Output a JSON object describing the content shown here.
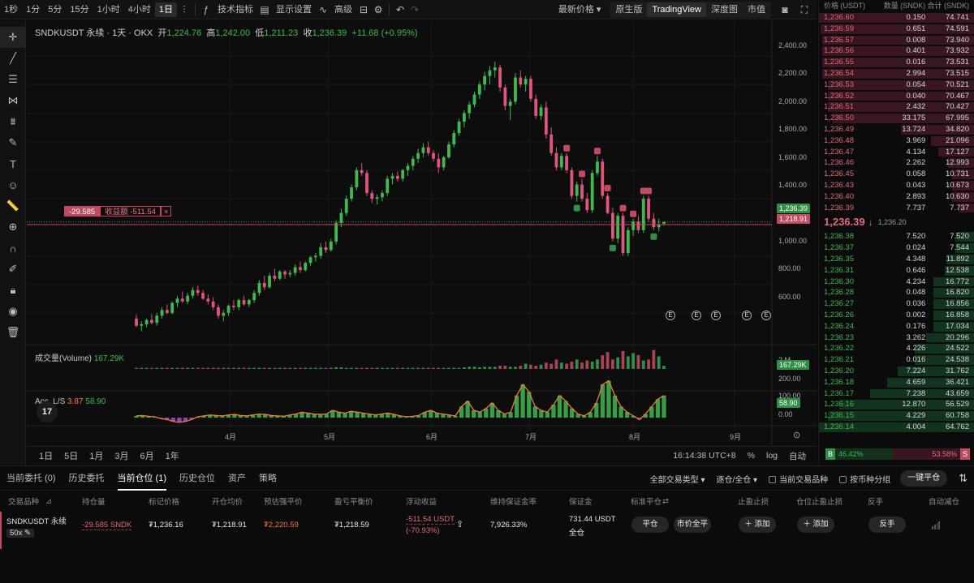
{
  "toolbar": {
    "intervals": [
      "1秒",
      "1分",
      "5分",
      "15分",
      "1小时",
      "4小时",
      "1日"
    ],
    "active_interval": "1日",
    "indicators": "技术指标",
    "display": "显示设置",
    "advanced": "高级",
    "price_type": "最新价格",
    "views": [
      "原生版",
      "TradingView",
      "深度图",
      "市值"
    ],
    "active_view": "TradingView"
  },
  "chart": {
    "legend": {
      "symbol": "SNDKUSDT 永续 · 1天 · OKX",
      "open_label": "开",
      "open": "1,224.76",
      "high_label": "高",
      "high": "1,242.00",
      "low_label": "低",
      "low": "1,211.23",
      "close_label": "收",
      "close": "1,236.39",
      "change": "+11.68 (+0.95%)"
    },
    "price_axis": [
      "2,400.00",
      "2,200.00",
      "2,000.00",
      "1,800.00",
      "1,600.00",
      "1,400.00",
      "1,000.00",
      "800.00",
      "600.00"
    ],
    "last_price_tag": "1,236.39",
    "entry_price_tag": "1,218.91",
    "position_tag": {
      "qty": "-29.585",
      "pnl": "收益额 -511.54",
      "close": "×"
    },
    "volume_legend": {
      "label": "成交量(Volume)",
      "value": "167.29K"
    },
    "volume_axis": "2 M",
    "volume_tag": "167.29K",
    "accls_legend": {
      "label": "Acc. L/S",
      "v1": "3.87",
      "v2": "58.90"
    },
    "accls_axis": [
      "200.00",
      "100.00",
      "0.00"
    ],
    "accls_tag": "58.90",
    "time_axis": [
      "4月",
      "5月",
      "6月",
      "7月",
      "8月",
      "9月"
    ],
    "ranges": [
      "1日",
      "5日",
      "1月",
      "3月",
      "6月",
      "1年"
    ],
    "clock": "16:14:38 UTC+8",
    "percent": "%",
    "log": "log",
    "auto": "自动",
    "badges": {
      "earnings": "E",
      "sell": "S",
      "buy": "B"
    }
  },
  "chart_data": {
    "type": "candlestick",
    "y_range": [
      480,
      2480
    ],
    "candles": [
      [
        560,
        590,
        500,
        510
      ],
      [
        510,
        540,
        470,
        520
      ],
      [
        520,
        560,
        500,
        550
      ],
      [
        550,
        590,
        520,
        530
      ],
      [
        530,
        600,
        510,
        580
      ],
      [
        580,
        640,
        560,
        620
      ],
      [
        620,
        660,
        590,
        600
      ],
      [
        600,
        680,
        590,
        670
      ],
      [
        670,
        720,
        640,
        700
      ],
      [
        700,
        750,
        670,
        680
      ],
      [
        680,
        740,
        660,
        720
      ],
      [
        720,
        780,
        700,
        760
      ],
      [
        760,
        790,
        720,
        740
      ],
      [
        740,
        760,
        690,
        700
      ],
      [
        700,
        730,
        660,
        680
      ],
      [
        680,
        710,
        620,
        640
      ],
      [
        640,
        660,
        560,
        580
      ],
      [
        580,
        620,
        540,
        600
      ],
      [
        600,
        660,
        580,
        650
      ],
      [
        650,
        690,
        620,
        640
      ],
      [
        640,
        700,
        620,
        690
      ],
      [
        690,
        720,
        650,
        660
      ],
      [
        660,
        700,
        640,
        690
      ],
      [
        690,
        760,
        670,
        740
      ],
      [
        740,
        830,
        720,
        810
      ],
      [
        810,
        860,
        760,
        780
      ],
      [
        780,
        880,
        770,
        860
      ],
      [
        860,
        910,
        820,
        840
      ],
      [
        840,
        900,
        830,
        890
      ],
      [
        890,
        900,
        840,
        870
      ],
      [
        870,
        900,
        850,
        880
      ],
      [
        880,
        940,
        860,
        920
      ],
      [
        920,
        960,
        880,
        900
      ],
      [
        900,
        960,
        890,
        950
      ],
      [
        950,
        1000,
        930,
        990
      ],
      [
        990,
        1020,
        960,
        1000
      ],
      [
        1000,
        1090,
        980,
        1060
      ],
      [
        1060,
        1100,
        1020,
        1040
      ],
      [
        1040,
        1120,
        1030,
        1100
      ],
      [
        1100,
        1250,
        1080,
        1230
      ],
      [
        1230,
        1330,
        1200,
        1300
      ],
      [
        1300,
        1420,
        1280,
        1400
      ],
      [
        1400,
        1500,
        1380,
        1480
      ],
      [
        1480,
        1620,
        1460,
        1600
      ],
      [
        1600,
        1650,
        1560,
        1580
      ],
      [
        1580,
        1600,
        1420,
        1440
      ],
      [
        1440,
        1460,
        1370,
        1400
      ],
      [
        1400,
        1430,
        1360,
        1410
      ],
      [
        1410,
        1460,
        1380,
        1440
      ],
      [
        1440,
        1560,
        1420,
        1540
      ],
      [
        1540,
        1580,
        1500,
        1560
      ],
      [
        1560,
        1590,
        1520,
        1540
      ],
      [
        1540,
        1610,
        1520,
        1600
      ],
      [
        1600,
        1650,
        1560,
        1630
      ],
      [
        1630,
        1700,
        1600,
        1680
      ],
      [
        1680,
        1750,
        1650,
        1720
      ],
      [
        1720,
        1790,
        1690,
        1760
      ],
      [
        1760,
        1800,
        1700,
        1720
      ],
      [
        1720,
        1740,
        1660,
        1680
      ],
      [
        1680,
        1720,
        1580,
        1620
      ],
      [
        1620,
        1700,
        1600,
        1690
      ],
      [
        1690,
        1800,
        1680,
        1780
      ],
      [
        1780,
        1880,
        1760,
        1860
      ],
      [
        1860,
        1960,
        1840,
        1940
      ],
      [
        1940,
        2020,
        1900,
        2000
      ],
      [
        2000,
        2080,
        1960,
        2060
      ],
      [
        2060,
        2150,
        2040,
        2130
      ],
      [
        2130,
        2220,
        2100,
        2200
      ],
      [
        2200,
        2290,
        2160,
        2260
      ],
      [
        2260,
        2330,
        2200,
        2300
      ],
      [
        2300,
        2360,
        2250,
        2320
      ],
      [
        2320,
        2340,
        2150,
        2180
      ],
      [
        2180,
        2200,
        2020,
        2050
      ],
      [
        2050,
        2100,
        1950,
        2080
      ],
      [
        2080,
        2280,
        2060,
        2250
      ],
      [
        2250,
        2300,
        2180,
        2200
      ],
      [
        2200,
        2260,
        2150,
        2240
      ],
      [
        2240,
        2260,
        2080,
        2100
      ],
      [
        2100,
        2130,
        1960,
        1980
      ],
      [
        1980,
        2060,
        1950,
        2040
      ],
      [
        2040,
        2080,
        1820,
        1850
      ],
      [
        1850,
        1900,
        1700,
        1720
      ],
      [
        1720,
        1760,
        1600,
        1620
      ],
      [
        1620,
        1720,
        1600,
        1700
      ],
      [
        1700,
        1720,
        1580,
        1600
      ],
      [
        1600,
        1620,
        1400,
        1420
      ],
      [
        1420,
        1520,
        1380,
        1500
      ],
      [
        1500,
        1540,
        1380,
        1400
      ],
      [
        1400,
        1440,
        1300,
        1320
      ],
      [
        1320,
        1600,
        1300,
        1580
      ],
      [
        1580,
        1700,
        1560,
        1660
      ],
      [
        1660,
        1680,
        1400,
        1420
      ],
      [
        1420,
        1440,
        1290,
        1300
      ],
      [
        1300,
        1340,
        1100,
        1120
      ],
      [
        1120,
        1300,
        1090,
        1280
      ],
      [
        1280,
        1300,
        1000,
        1020
      ],
      [
        1020,
        1200,
        1000,
        1180
      ],
      [
        1180,
        1260,
        1140,
        1240
      ],
      [
        1240,
        1280,
        1160,
        1180
      ],
      [
        1180,
        1420,
        1160,
        1400
      ],
      [
        1400,
        1420,
        1240,
        1260
      ],
      [
        1260,
        1300,
        1180,
        1200
      ],
      [
        1200,
        1260,
        1170,
        1220
      ],
      [
        1224.76,
        1242,
        1211.23,
        1236.39
      ]
    ],
    "volume": [
      0.1,
      0.1,
      0.1,
      0.1,
      0.1,
      0.1,
      0.1,
      0.1,
      0.1,
      0.1,
      0.1,
      0.1,
      0.1,
      0.1,
      0.1,
      0.1,
      0.1,
      0.1,
      0.1,
      0.1,
      0.1,
      0.1,
      0.1,
      0.1,
      0.1,
      0.1,
      0.1,
      0.1,
      0.1,
      0.1,
      0.1,
      0.1,
      0.1,
      0.1,
      0.1,
      0.1,
      0.1,
      0.1,
      0.1,
      0.15,
      0.15,
      0.1,
      0.1,
      0.1,
      0.1,
      0.1,
      0.1,
      0.1,
      0.1,
      0.1,
      0.1,
      0.1,
      0.1,
      0.1,
      0.1,
      0.1,
      0.1,
      0.1,
      0.1,
      0.1,
      0.1,
      0.1,
      0.1,
      0.1,
      0.15,
      0.2,
      0.2,
      0.15,
      0.2,
      0.2,
      0.2,
      0.3,
      0.3,
      0.2,
      0.2,
      0.3,
      0.5,
      0.4,
      0.3,
      0.4,
      0.6,
      0.5,
      0.9,
      0.6,
      0.5,
      0.7,
      0.9,
      0.6,
      0.8,
      0.7,
      0.9,
      1.3,
      1.6,
      0.9,
      1.1,
      1.7,
      1.2,
      1.5,
      1.3,
      0.8,
      0.9,
      1.8,
      1.2,
      0.3,
      0.17
    ],
    "acc_ls": [
      10,
      12,
      8,
      5,
      -5,
      -10,
      -20,
      -25,
      -20,
      -10,
      5,
      10,
      15,
      12,
      10,
      15,
      18,
      12,
      10,
      15,
      20,
      18,
      12,
      10,
      8,
      15,
      20,
      30,
      25,
      20,
      18,
      20,
      40,
      30,
      25,
      35,
      30,
      25,
      20,
      15,
      20,
      25,
      18,
      10,
      5,
      8,
      12,
      30,
      40,
      25,
      20,
      15,
      10,
      60,
      90,
      40,
      30,
      50,
      80,
      40,
      20,
      30,
      120,
      180,
      140,
      60,
      40,
      30,
      70,
      120,
      90,
      50,
      20,
      10,
      30,
      80,
      180,
      200,
      120,
      60,
      30,
      10,
      -10,
      20,
      60,
      100,
      120
    ],
    "time_axis": [
      "4月",
      "5月",
      "6月",
      "7月",
      "8月",
      "9月"
    ]
  },
  "orderbook": {
    "headers": [
      "价格 (USDT)",
      "数量 (SNDK)",
      "合计 (SNDK)"
    ],
    "asks": [
      [
        "1,236.60",
        "0.150",
        "74.741"
      ],
      [
        "1,236.59",
        "0.651",
        "74.591"
      ],
      [
        "1,236.57",
        "0.008",
        "73.940"
      ],
      [
        "1,236.56",
        "0.401",
        "73.932"
      ],
      [
        "1,236.55",
        "0.016",
        "73.531"
      ],
      [
        "1,236.54",
        "2.994",
        "73.515"
      ],
      [
        "1,236.53",
        "0.054",
        "70.521"
      ],
      [
        "1,236.52",
        "0.040",
        "70.467"
      ],
      [
        "1,236.51",
        "2.432",
        "70.427"
      ],
      [
        "1,236.50",
        "33.175",
        "67.995"
      ],
      [
        "1,236.49",
        "13.724",
        "34.820"
      ],
      [
        "1,236.48",
        "3.969",
        "21.096"
      ],
      [
        "1,236.47",
        "4.134",
        "17.127"
      ],
      [
        "1,236.46",
        "2.262",
        "12.993"
      ],
      [
        "1,236.45",
        "0.058",
        "10.731"
      ],
      [
        "1,236.43",
        "0.043",
        "10.673"
      ],
      [
        "1,236.40",
        "2.893",
        "10.630"
      ],
      [
        "1,236.39",
        "7.737",
        "7.737"
      ]
    ],
    "ask_fill": [
      1,
      0.99,
      0.98,
      0.98,
      0.98,
      0.98,
      0.94,
      0.94,
      0.94,
      0.91,
      0.47,
      0.28,
      0.23,
      0.17,
      0.14,
      0.14,
      0.14,
      0.1
    ],
    "last_price": "1,236.39",
    "last_arrow": "↓",
    "mark_price": "1,236.20",
    "bids": [
      [
        "1,236.38",
        "7.520",
        "7.520"
      ],
      [
        "1,236.37",
        "0.024",
        "7.544"
      ],
      [
        "1,236.35",
        "4.348",
        "11.892"
      ],
      [
        "1,236.31",
        "0.646",
        "12.538"
      ],
      [
        "1,236.30",
        "4.234",
        "16.772"
      ],
      [
        "1,236.28",
        "0.048",
        "16.820"
      ],
      [
        "1,236.27",
        "0.036",
        "16.856"
      ],
      [
        "1,236.26",
        "0.002",
        "16.858"
      ],
      [
        "1,236.24",
        "0.176",
        "17.034"
      ],
      [
        "1,236.23",
        "3.262",
        "20.296"
      ],
      [
        "1,236.22",
        "4.226",
        "24.522"
      ],
      [
        "1,236.21",
        "0.016",
        "24.538"
      ],
      [
        "1,236.20",
        "7.224",
        "31.762"
      ],
      [
        "1,236.18",
        "4.659",
        "36.421"
      ],
      [
        "1,236.17",
        "7.238",
        "43.659"
      ],
      [
        "1,236.16",
        "12.870",
        "56.529"
      ],
      [
        "1,236.15",
        "4.229",
        "60.758"
      ],
      [
        "1,236.14",
        "4.004",
        "64.762"
      ]
    ],
    "bid_fill": [
      0.12,
      0.12,
      0.18,
      0.19,
      0.26,
      0.26,
      0.26,
      0.26,
      0.26,
      0.31,
      0.38,
      0.38,
      0.49,
      0.56,
      0.67,
      0.87,
      0.94,
      1
    ],
    "buy_ratio": "46.42%",
    "sell_ratio": "53.58%",
    "buy_ratio_value": 0.4642,
    "buy_icon": "B",
    "sell_icon": "S"
  },
  "positions": {
    "tabs": [
      "当前委托 (0)",
      "历史委托",
      "当前仓位 (1)",
      "历史仓位",
      "资产",
      "策略"
    ],
    "active_tab": "当前仓位 (1)",
    "filter_type": "全部交易类型",
    "filter_mode": "逐仓/全仓",
    "check_current": "当前交易品种",
    "check_group": "按币种分组",
    "close_all": "一键平仓",
    "headers": [
      "交易品种",
      "持仓量",
      "标记价格",
      "开仓均价",
      "预估强平价",
      "盈亏平衡价",
      "浮动收益",
      "维持保证金率",
      "保证金",
      "标准平仓",
      "止盈止损",
      "仓位止盈止损",
      "反手",
      "自动减仓"
    ],
    "row": {
      "symbol": "SNDKUSDT 永续",
      "leverage": "50x",
      "qty": "-29.585 SNDK",
      "mark": "₮1,236.16",
      "entry": "₮1,218.91",
      "liq": "₮2,220.59",
      "breakeven": "₮1,218.59",
      "pnl": "-511.54 USDT",
      "pnl_pct": "(-70.93%)",
      "mmr": "7,926.33%",
      "margin": "731.44 USDT",
      "margin_mode": "全仓",
      "close_btn": "平仓",
      "market_close_btn": "市价全平",
      "tp_add": "＋ 添加",
      "pos_tp_add": "＋ 添加",
      "reverse": "反手"
    }
  }
}
